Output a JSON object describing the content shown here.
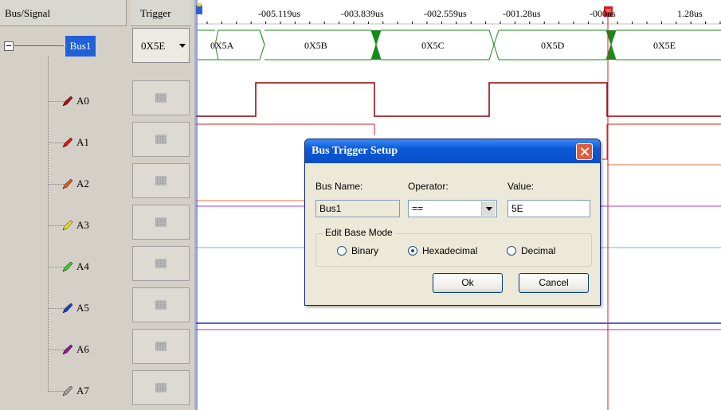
{
  "columns": {
    "bus_signal": "Bus/Signal",
    "trigger": "Trigger"
  },
  "bus": {
    "name": "Bus1",
    "trigger_value": "0X5E"
  },
  "signals": [
    {
      "label": "A0",
      "pen_color": "#b01010"
    },
    {
      "label": "A1",
      "pen_color": "#e01818"
    },
    {
      "label": "A2",
      "pen_color": "#d86020"
    },
    {
      "label": "A3",
      "pen_color": "#f0e020"
    },
    {
      "label": "A4",
      "pen_color": "#30d030"
    },
    {
      "label": "A5",
      "pen_color": "#1840d0"
    },
    {
      "label": "A6",
      "pen_color": "#901890"
    },
    {
      "label": "A7",
      "pen_color": "#a0a0a0"
    }
  ],
  "ruler": {
    "ticks": [
      "-005.119us",
      "-003.839us",
      "-002.559us",
      "-001.28us",
      "-000ns",
      "1.28us"
    ]
  },
  "bus_values": [
    "0X5A",
    "0X5B",
    "0X5C",
    "0X5D",
    "0X5E"
  ],
  "dialog": {
    "title": "Bus Trigger Setup",
    "bus_name_label": "Bus Name:",
    "operator_label": "Operator:",
    "value_label": "Value:",
    "bus_name": "Bus1",
    "operator": "==",
    "value": "5E",
    "group_title": "Edit Base Mode",
    "modes": [
      "Binary",
      "Hexadecimal",
      "Decimal"
    ],
    "selected_mode": "Hexadecimal",
    "ok_label": "Ok",
    "cancel_label": "Cancel"
  },
  "colors": {
    "selection": "#2060d8",
    "trigger_marker": "#d02020",
    "bus_edge": "#1a8a1a",
    "a0_trace": "#900000"
  }
}
